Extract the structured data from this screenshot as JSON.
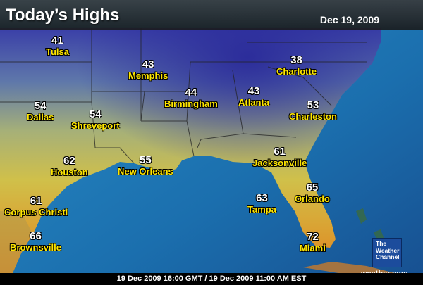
{
  "title": "Today’s Highs",
  "date": "Dec 19, 2009",
  "footer": "19 Dec 2009 16:00 GMT / 19 Dec 2009 11:00 AM EST",
  "logo": {
    "line1": "The",
    "line2": "Weather",
    "line3": "Channel"
  },
  "website": "weather.com",
  "cities": [
    {
      "name": "Tulsa",
      "temp": "41"
    },
    {
      "name": "Memphis",
      "temp": "43"
    },
    {
      "name": "Charlotte",
      "temp": "38"
    },
    {
      "name": "Birmingham",
      "temp": "44"
    },
    {
      "name": "Atlanta",
      "temp": "43"
    },
    {
      "name": "Charleston",
      "temp": "53"
    },
    {
      "name": "Dallas",
      "temp": "54"
    },
    {
      "name": "Shreveport",
      "temp": "54"
    },
    {
      "name": "Jacksonville",
      "temp": "61"
    },
    {
      "name": "Houston",
      "temp": "62"
    },
    {
      "name": "New Orleans",
      "temp": "55"
    },
    {
      "name": "Orlando",
      "temp": "65"
    },
    {
      "name": "Tampa",
      "temp": "63"
    },
    {
      "name": "Corpus Christi",
      "temp": "61"
    },
    {
      "name": "Brownsville",
      "temp": "66"
    },
    {
      "name": "Miami",
      "temp": "72"
    }
  ],
  "colors": {
    "cold": "#2a2f9a",
    "cool": "#6a86a8",
    "mild": "#c8bc48",
    "warm": "#d9a030",
    "hot": "#e07a20",
    "ocean": "#1f78b0",
    "label": "#ffe600"
  }
}
